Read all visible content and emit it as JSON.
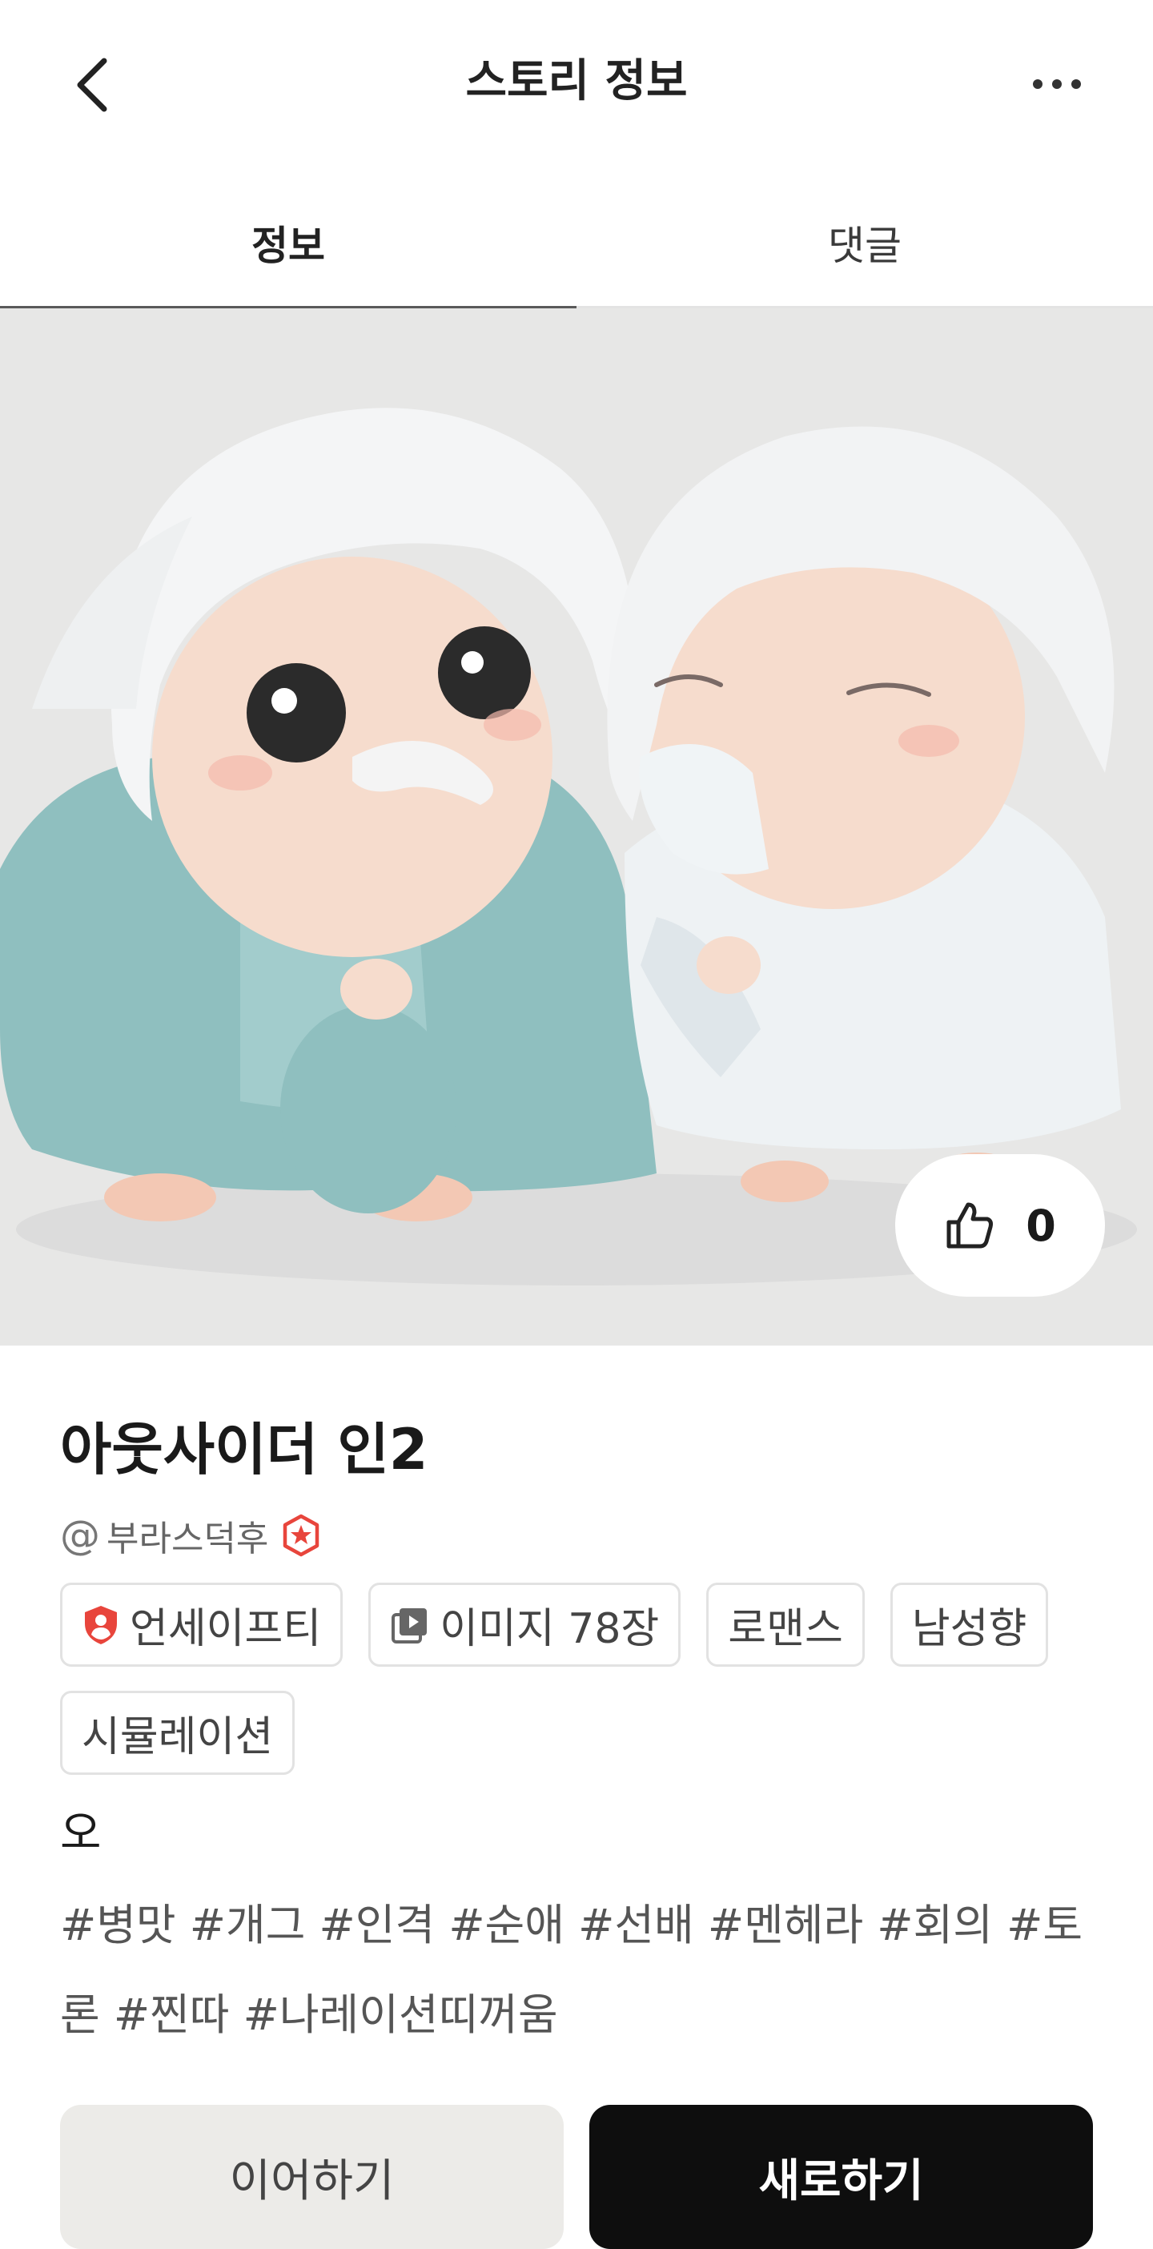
{
  "header": {
    "title": "스토리 정보",
    "back_icon": "chevron-left-icon",
    "more_icon": "more-horizontal-icon"
  },
  "tabs": [
    {
      "label": "정보",
      "active": true
    },
    {
      "label": "댓글",
      "active": false
    }
  ],
  "hero": {
    "like_icon": "thumbs-up-icon",
    "like_count": "0"
  },
  "story": {
    "title": "아웃사이더 인2",
    "author_prefix": "@",
    "author": "부라스덕후",
    "author_badge_icon": "star-badge-icon",
    "tags": [
      {
        "label": "언세이프티",
        "icon": "shield-user-icon"
      },
      {
        "label": "이미지 78장",
        "icon": "image-stack-icon"
      },
      {
        "label": "로맨스"
      },
      {
        "label": "남성향"
      },
      {
        "label": "시뮬레이션"
      }
    ],
    "description": "오",
    "hashtags": "#병맛 #개그 #인격 #순애 #선배 #멘헤라 #회의 #토론 #찐따 #나레이션띠꺼움"
  },
  "actions": {
    "continue_label": "이어하기",
    "new_label": "새로하기"
  },
  "colors": {
    "accent_red": "#e8453c",
    "primary_button": "#0e0e0e",
    "secondary_button": "#ecebe8"
  }
}
